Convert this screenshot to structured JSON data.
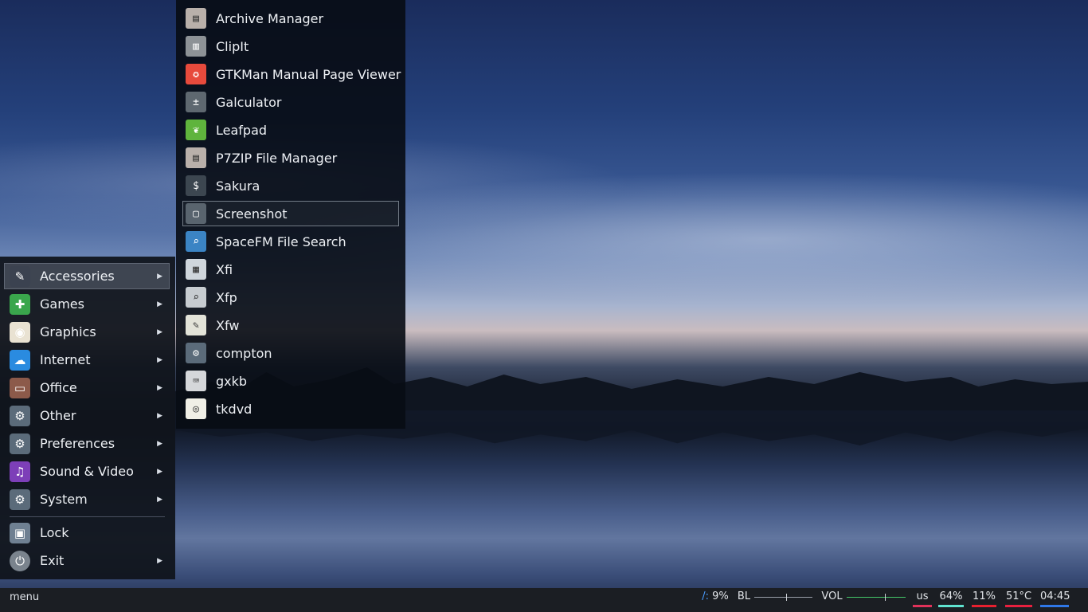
{
  "main_menu": {
    "items": [
      {
        "label": "Accessories",
        "icon": "accessories-icon",
        "color": "#3b4250",
        "glyph": "✎",
        "arrow": "▶",
        "active": true
      },
      {
        "label": "Games",
        "icon": "gamepad-icon",
        "color": "#3aa64c",
        "glyph": "✚",
        "arrow": "▶"
      },
      {
        "label": "Graphics",
        "icon": "palette-icon",
        "color": "#e9e2d2",
        "glyph": "◉",
        "arrow": "▶"
      },
      {
        "label": "Internet",
        "icon": "cloud-icon",
        "color": "#2a8be0",
        "glyph": "☁",
        "arrow": "▶"
      },
      {
        "label": "Office",
        "icon": "briefcase-icon",
        "color": "#8c5a4a",
        "glyph": "▭",
        "arrow": "▶"
      },
      {
        "label": "Other",
        "icon": "gear-icon",
        "color": "#5b6b7a",
        "glyph": "⚙",
        "arrow": "▶"
      },
      {
        "label": "Preferences",
        "icon": "gear-icon",
        "color": "#5b6b7a",
        "glyph": "⚙",
        "arrow": "▶"
      },
      {
        "label": "Sound & Video",
        "icon": "music-icon",
        "color": "#7d3fb8",
        "glyph": "♫",
        "arrow": "▶"
      },
      {
        "label": "System",
        "icon": "gear-icon",
        "color": "#5b6b7a",
        "glyph": "⚙",
        "arrow": "▶"
      }
    ],
    "lock": {
      "label": "Lock",
      "icon": "lock-screen-icon",
      "color": "#6f8092",
      "glyph": "▣"
    },
    "exit": {
      "label": "Exit",
      "icon": "power-icon",
      "color": "#7a838d",
      "glyph": "⏻",
      "arrow": "▶"
    }
  },
  "submenu": {
    "items": [
      {
        "label": "Archive Manager",
        "icon": "archive-icon",
        "color": "#b9b0aa",
        "glyph": "▤"
      },
      {
        "label": "ClipIt",
        "icon": "clipboard-icon",
        "color": "#8d9296",
        "glyph": "▥"
      },
      {
        "label": "GTKMan Manual Page Viewer",
        "icon": "lifebuoy-icon",
        "color": "#e74a3c",
        "glyph": "✪"
      },
      {
        "label": "Galculator",
        "icon": "calculator-icon",
        "color": "#5e6870",
        "glyph": "±"
      },
      {
        "label": "Leafpad",
        "icon": "leaf-icon",
        "color": "#5fb43d",
        "glyph": "❦"
      },
      {
        "label": "P7ZIP File Manager",
        "icon": "archive-icon",
        "color": "#b9b0aa",
        "glyph": "▤"
      },
      {
        "label": "Sakura",
        "icon": "terminal-icon",
        "color": "#3c4650",
        "glyph": "$"
      },
      {
        "label": "Screenshot",
        "icon": "screenshot-icon",
        "color": "#59646e",
        "glyph": "▢",
        "hover": true
      },
      {
        "label": "SpaceFM File Search",
        "icon": "magnifier-icon",
        "color": "#3b84c4",
        "glyph": "⌕"
      },
      {
        "label": "Xfi",
        "icon": "system-info-icon",
        "color": "#cfd6dc",
        "glyph": "▦"
      },
      {
        "label": "Xfp",
        "icon": "search-folder-icon",
        "color": "#c7ccd0",
        "glyph": "⌕"
      },
      {
        "label": "Xfw",
        "icon": "document-edit-icon",
        "color": "#e3e3d8",
        "glyph": "✎"
      },
      {
        "label": "compton",
        "icon": "gear-icon",
        "color": "#5b6b7a",
        "glyph": "⚙"
      },
      {
        "label": "gxkb",
        "icon": "keyboard-icon",
        "color": "#d5d7da",
        "glyph": "⌨"
      },
      {
        "label": "tkdvd",
        "icon": "dvd-icon",
        "color": "#f0efe6",
        "glyph": "◎"
      }
    ]
  },
  "taskbar": {
    "menu_label": "menu",
    "disk": {
      "path": "/:",
      "value": "9%",
      "path_color": "#4a9cff"
    },
    "backlight": {
      "label": "BL",
      "level": 0.55
    },
    "volume": {
      "label": "VOL",
      "level": 0.65,
      "color": "#44c76a"
    },
    "keyboard_layout": {
      "label": "us",
      "color": "#e0325a"
    },
    "battery": {
      "label": "64%",
      "color": "#5fe3d0"
    },
    "cpu": {
      "label": "11%",
      "color": "#e8202f"
    },
    "temperature": {
      "label": "51°C",
      "color": "#e8203f"
    },
    "clock": {
      "label": "04:45",
      "color": "#2f78e8"
    }
  }
}
